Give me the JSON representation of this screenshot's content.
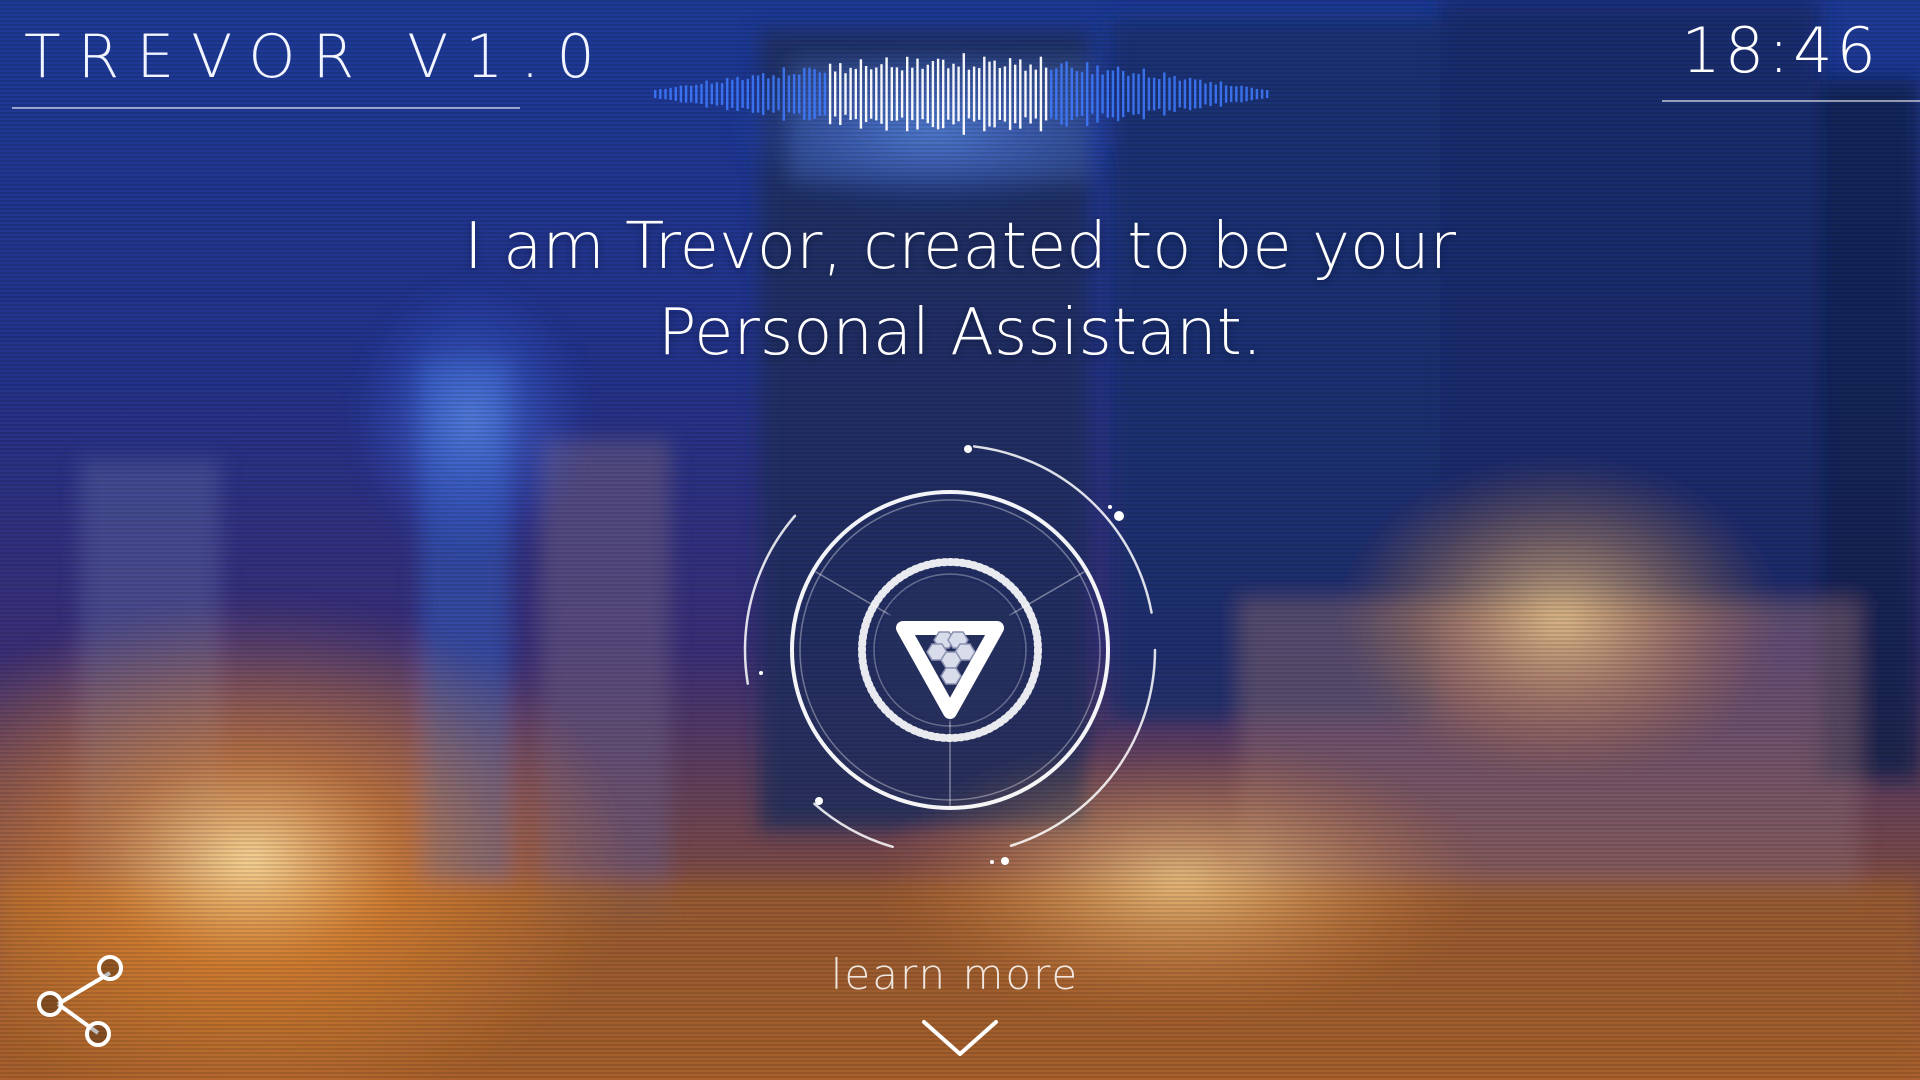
{
  "header": {
    "app_title": "TREVOR V1.0",
    "clock": "18:46"
  },
  "hero": {
    "line1": "I am Trevor, created to be your",
    "line2": "Personal Assistant."
  },
  "assistant": {
    "logo_icon": "triangle-hexagon-logo-icon",
    "status": "listening"
  },
  "footer": {
    "learn_more_label": "learn more",
    "share_icon": "share-icon",
    "chevron_icon": "chevron-down-icon"
  },
  "colors": {
    "accent": "#2f6bff",
    "bg_dark": "#16265f",
    "bg_warm": "#f0a030",
    "text": "#ffffff"
  }
}
